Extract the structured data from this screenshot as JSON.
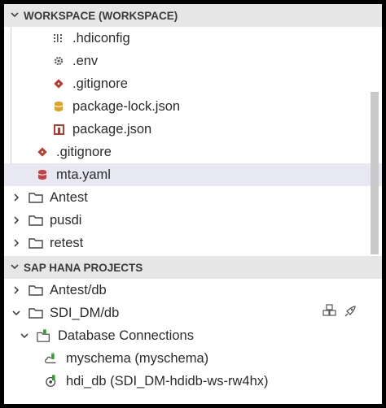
{
  "workspace": {
    "title": "WORKSPACE (WORKSPACE)",
    "items": [
      {
        "label": ".hdiconfig",
        "icon": "hdiconfig-icon"
      },
      {
        "label": ".env",
        "icon": "gear-icon"
      },
      {
        "label": ".gitignore",
        "icon": "git-icon"
      },
      {
        "label": "package-lock.json",
        "icon": "database-icon"
      },
      {
        "label": "package.json",
        "icon": "package-icon"
      },
      {
        "label": ".gitignore",
        "icon": "git-icon"
      },
      {
        "label": "mta.yaml",
        "icon": "database-icon"
      },
      {
        "label": "Antest",
        "icon": "folder-icon"
      },
      {
        "label": "pusdi",
        "icon": "folder-icon"
      },
      {
        "label": "retest",
        "icon": "folder-icon"
      }
    ]
  },
  "hana": {
    "title": "SAP HANA PROJECTS",
    "items": [
      {
        "label": "Antest/db"
      },
      {
        "label": "SDI_DM/db"
      },
      {
        "label": "Database Connections"
      },
      {
        "label": "myschema (myschema)"
      },
      {
        "label": "hdi_db (SDI_DM-hdidb-ws-rw4hx)"
      }
    ]
  },
  "colors": {
    "git": "#b83a2c",
    "json": "#e0a020",
    "package": "#b83a2c",
    "plug": "#2ea02e",
    "yaml": "#c44444"
  }
}
